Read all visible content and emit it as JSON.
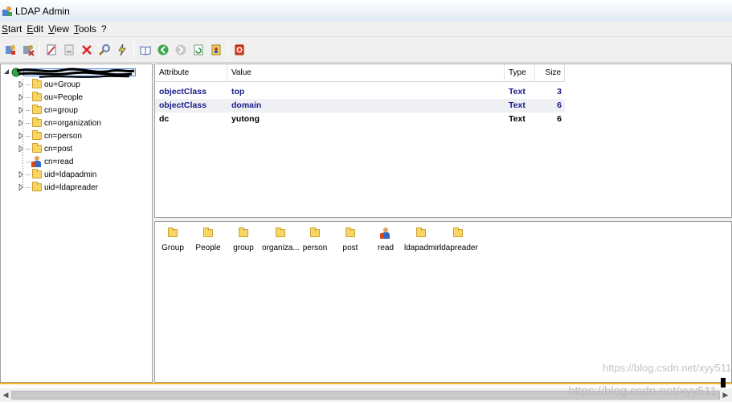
{
  "window": {
    "title": "LDAP Admin"
  },
  "menu": [
    "Start",
    "Edit",
    "View",
    "Tools",
    "?"
  ],
  "toolbar": {
    "buttons": [
      "connect-icon",
      "disconnect-icon",
      "edit-icon",
      "rename-icon",
      "delete-icon",
      "search-icon",
      "lightning-icon",
      "book-icon",
      "back-icon",
      "forward-icon",
      "refresh-icon",
      "export-icon",
      "exit-icon"
    ]
  },
  "tree": {
    "root_label": "",
    "items": [
      {
        "label": "ou=Group",
        "icon": "folder-ou"
      },
      {
        "label": "ou=People",
        "icon": "folder-ou"
      },
      {
        "label": "cn=group",
        "icon": "folder"
      },
      {
        "label": "cn=organization",
        "icon": "folder"
      },
      {
        "label": "cn=person",
        "icon": "folder"
      },
      {
        "label": "cn=post",
        "icon": "folder"
      },
      {
        "label": "cn=read",
        "icon": "person"
      },
      {
        "label": "uid=ldapadmin",
        "icon": "folder"
      },
      {
        "label": "uid=ldapreader",
        "icon": "folder"
      }
    ]
  },
  "attributes": {
    "headers": {
      "attribute": "Attribute",
      "value": "Value",
      "type": "Type",
      "size": "Size"
    },
    "rows": [
      {
        "attribute": "objectClass",
        "value": "top",
        "type": "Text",
        "size": "3",
        "color": "#1a1a8c"
      },
      {
        "attribute": "objectClass",
        "value": "domain",
        "type": "Text",
        "size": "6",
        "color": "#1a1a8c"
      },
      {
        "attribute": "dc",
        "value": "yutong",
        "type": "Text",
        "size": "6",
        "color": "#000000"
      }
    ]
  },
  "children": [
    {
      "label": "Group",
      "icon": "folder-ou"
    },
    {
      "label": "People",
      "icon": "folder-ou"
    },
    {
      "label": "group",
      "icon": "folder"
    },
    {
      "label": "organiza...",
      "icon": "folder"
    },
    {
      "label": "person",
      "icon": "folder"
    },
    {
      "label": "post",
      "icon": "folder"
    },
    {
      "label": "read",
      "icon": "person"
    },
    {
      "label": "ldapadmin",
      "icon": "folder"
    },
    {
      "label": "ldapreader",
      "icon": "folder"
    }
  ],
  "watermarks": [
    "https://blog.csdn.net/xyy511",
    "https://blog.csdn.net/xyy511"
  ],
  "colors": {
    "accent_line": "#f5b32a",
    "link_blue": "#1a1a8c"
  }
}
